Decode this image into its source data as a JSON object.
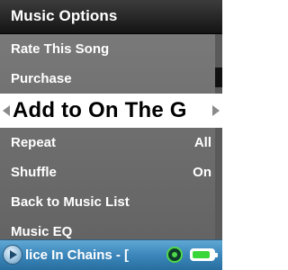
{
  "title": "Music Options",
  "menu": {
    "items": [
      {
        "label": "Rate This Song",
        "value": ""
      },
      {
        "label": "Purchase",
        "value": ""
      },
      {
        "label": "Add to On The G",
        "value": "",
        "selected": true
      },
      {
        "label": "Repeat",
        "value": "All"
      },
      {
        "label": "Shuffle",
        "value": "On"
      },
      {
        "label": "Back to Music List",
        "value": ""
      },
      {
        "label": "Music EQ",
        "value": ""
      }
    ]
  },
  "now_playing": {
    "text": "lice In Chains - [",
    "battery_level": 0.85
  },
  "icons": {
    "play": "play-icon",
    "sync": "sync-icon",
    "battery": "battery-icon",
    "left_arrow": "chevron-left-icon",
    "right_arrow": "chevron-right-icon"
  },
  "colors": {
    "title_bg": "#262626",
    "menu_bg": "#6f6f6f",
    "selected_bg": "#ffffff",
    "now_playing_bg": "#3b86bb",
    "battery_fill": "#39d63a",
    "sync_accent": "#4fd64a"
  }
}
